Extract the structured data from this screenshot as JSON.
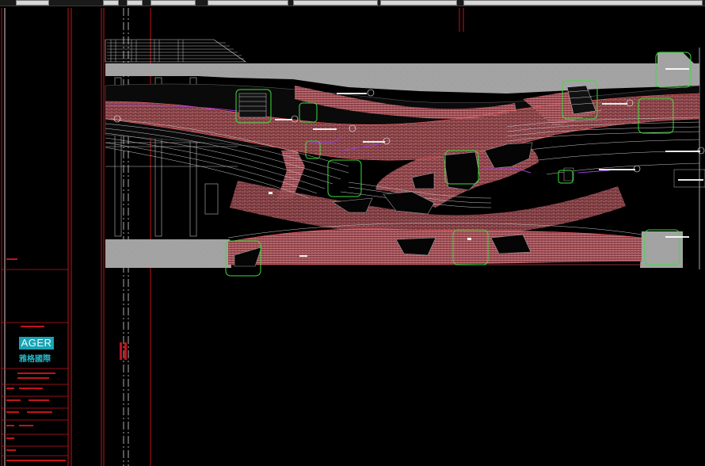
{
  "app": {
    "type": "CAD drawing viewer",
    "background_color": "#000000"
  },
  "title_block": {
    "logo_text": "AGER",
    "logo_subtitle": "雅格國際",
    "logo_color": "#1aa3b4"
  },
  "colors": {
    "frame_red": "#c0141e",
    "plaza_gray": "#a3a3a3",
    "paving_pink": "#b8646a",
    "paving_hatch": "#e08a8a",
    "tree_green": "#3cdc3c",
    "annotation_white": "#ffffff",
    "centerline_white": "#d8d8d8",
    "purple_line": "#9b3bd6"
  },
  "icons": [
    "tree-symbol-icon",
    "section-marker-icon"
  ]
}
